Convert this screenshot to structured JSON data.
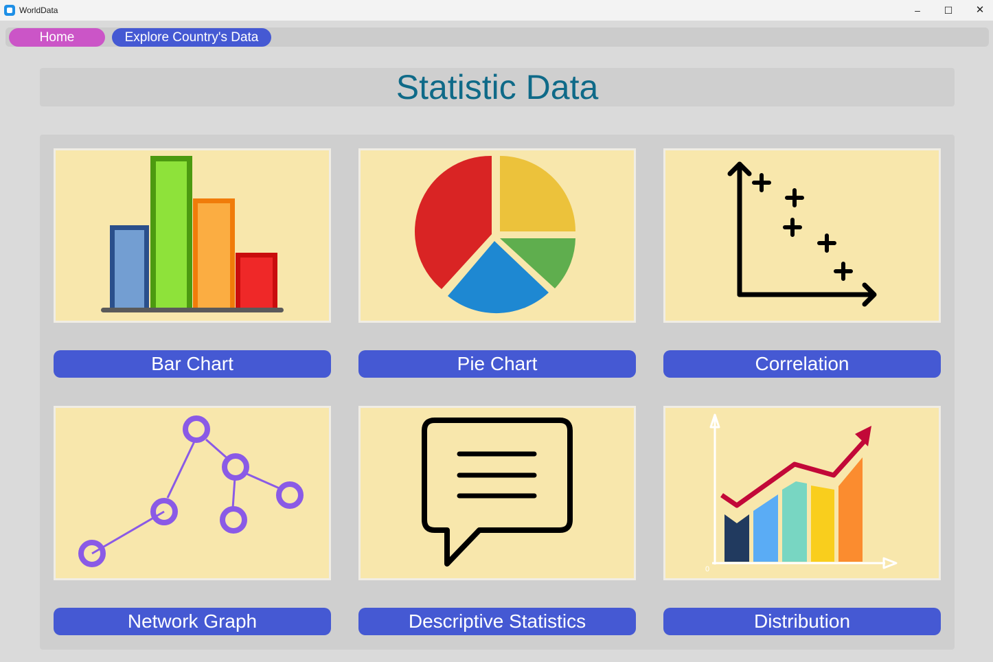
{
  "window": {
    "title": "WorldData",
    "minimize_icon": "–",
    "maximize_icon": "☐",
    "close_icon": "✕"
  },
  "nav": {
    "home": "Home",
    "explore": "Explore Country's Data"
  },
  "header": {
    "title": "Statistic Data"
  },
  "cards": [
    {
      "label": "Bar Chart",
      "icon": "bar-chart-icon"
    },
    {
      "label": "Pie Chart",
      "icon": "pie-chart-icon"
    },
    {
      "label": "Correlation",
      "icon": "scatter-plot-icon"
    },
    {
      "label": "Network Graph",
      "icon": "network-graph-icon"
    },
    {
      "label": "Descriptive Statistics",
      "icon": "speech-bubble-icon"
    },
    {
      "label": "Distribution",
      "icon": "growth-chart-icon"
    }
  ],
  "illustration_labels": {
    "distribution_origin": "0"
  },
  "colors": {
    "nav_home": "#cb55c7",
    "button_blue": "#4559d3",
    "title_teal": "#0f6a88",
    "card_bg": "#f8e7ac"
  }
}
